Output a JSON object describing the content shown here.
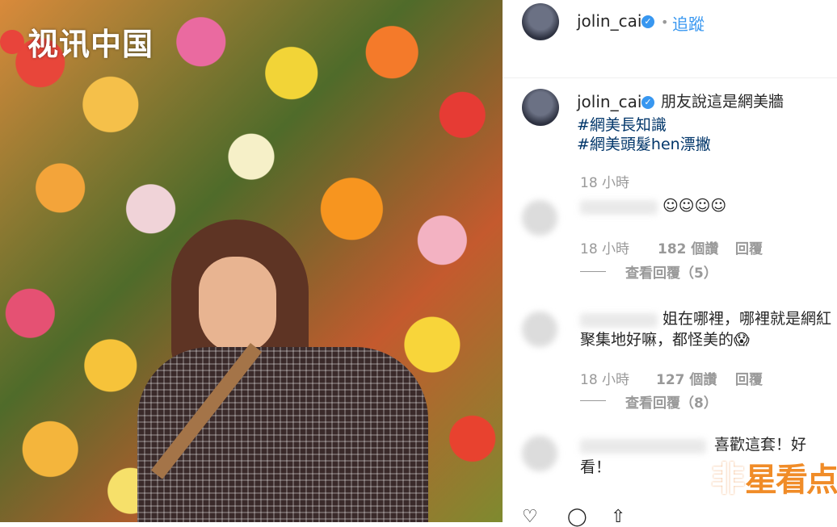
{
  "watermark_left": {
    "text": "视讯中国"
  },
  "watermark_right": {
    "glyph": "非",
    "text": "星看点"
  },
  "post": {
    "author": "jolin_cai",
    "follow_label": "追蹤",
    "separator": "•",
    "more_icon": "⋮"
  },
  "caption": {
    "author": "jolin_cai",
    "text": "朋友說這是網美牆",
    "hashtags": [
      "#網美長知識",
      "#網美頭髮hen漂撇"
    ],
    "time": "18 小時"
  },
  "comments": [
    {
      "text": "☺☺☺☺",
      "time": "18 小時",
      "likes": "182 個讚",
      "reply_label": "回覆",
      "view_replies": "查看回覆（5）"
    },
    {
      "text_line1": "姐在哪裡，哪裡就是網紅",
      "text_line2": "聚集地好嘛，都怪美的😱",
      "time": "18 小時",
      "likes": "127 個讚",
      "reply_label": "回覆",
      "view_replies": "查看回覆（8）"
    },
    {
      "text_line1": "喜歡這套！好",
      "text_line2": "看！"
    }
  ],
  "icons": {
    "verified": "✓",
    "like": "heart-icon",
    "comment": "comment-icon",
    "share": "share-icon"
  }
}
